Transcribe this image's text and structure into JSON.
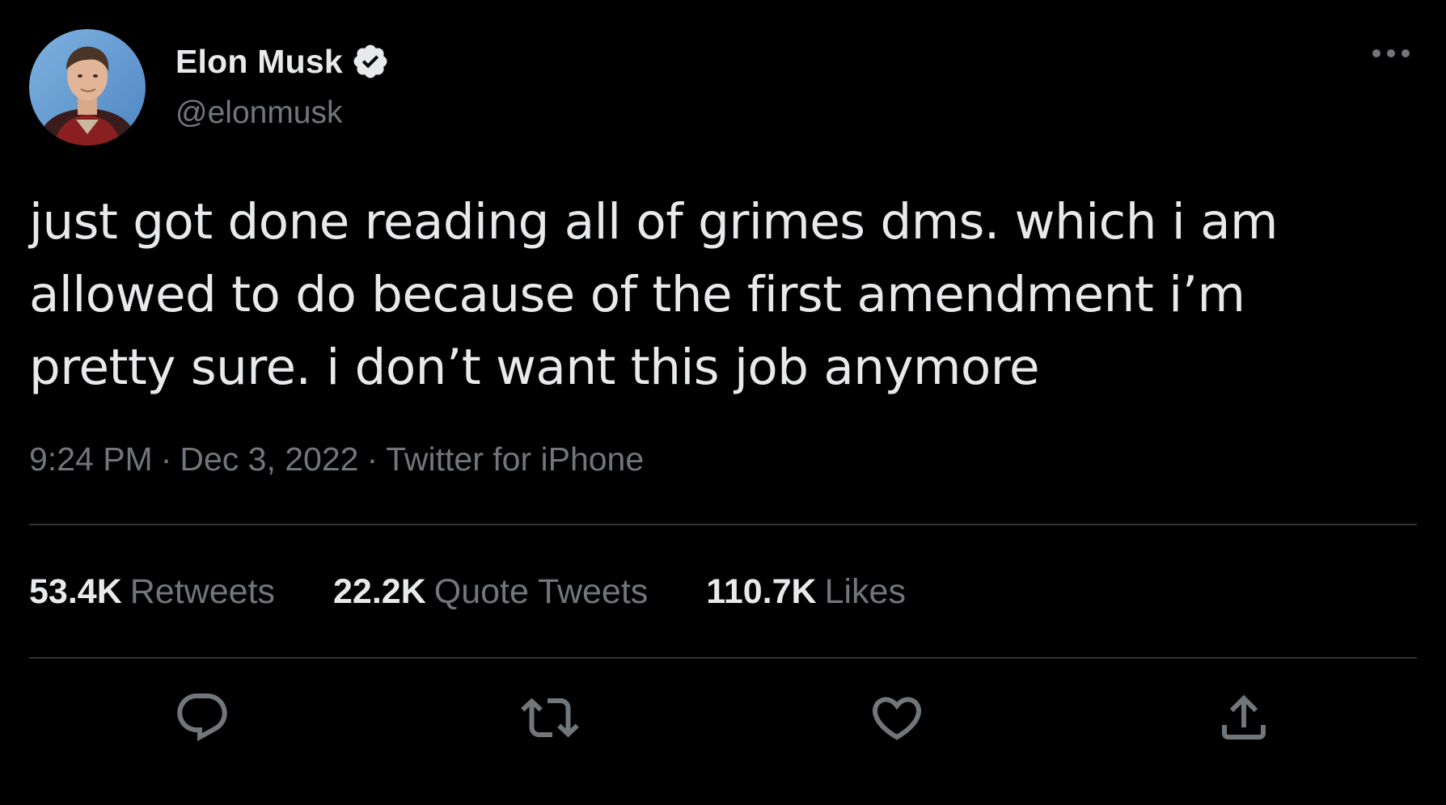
{
  "author": {
    "display_name": "Elon Musk",
    "handle": "@elonmusk",
    "verified": true
  },
  "tweet": {
    "text": "just got done reading all of grimes dms. which i am allowed to do because of the first amendment i’m pretty sure. i don’t want this job anymore",
    "time": "9:24 PM",
    "separator": "·",
    "date": "Dec 3, 2022",
    "source": "Twitter for iPhone"
  },
  "stats": {
    "retweets": {
      "count": "53.4K",
      "label": "Retweets"
    },
    "quotes": {
      "count": "22.2K",
      "label": "Quote Tweets"
    },
    "likes": {
      "count": "110.7K",
      "label": "Likes"
    }
  },
  "icons": {
    "verified": "verified-badge-icon",
    "more": "more-options-icon",
    "reply": "reply-icon",
    "retweet": "retweet-icon",
    "like": "heart-icon",
    "share": "share-icon"
  },
  "colors": {
    "background": "#000000",
    "primary_text": "#e7e9ea",
    "secondary_text": "#71767b",
    "divider": "#2f3336"
  }
}
